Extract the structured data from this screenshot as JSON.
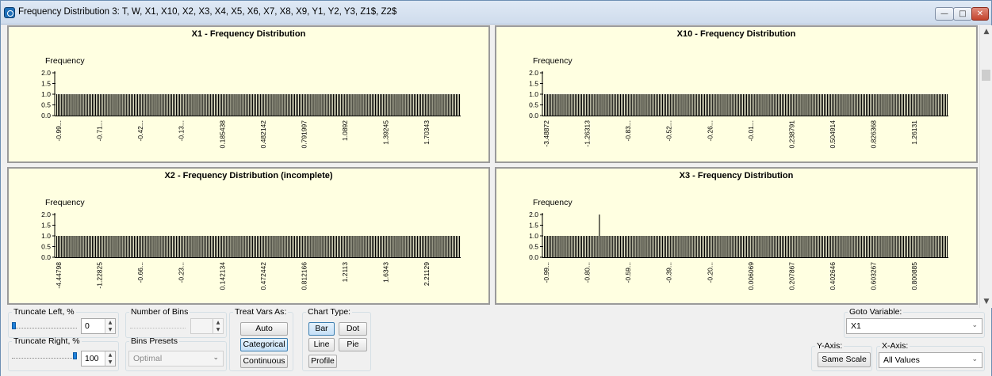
{
  "window": {
    "title": "Frequency Distribution 3: T, W, X1, X10, X2, X3, X4, X5, X6, X7, X8, X9, Y1, Y2, Y3, Z1$, Z2$",
    "controls": [
      "minimize",
      "maximize",
      "close"
    ]
  },
  "charts": [
    {
      "id": "x1",
      "title": "X1 - Frequency Distribution",
      "ylabel": "Frequency",
      "y_ticks": [
        "2.0",
        "1.5",
        "1.0",
        "0.5",
        "0.0"
      ],
      "x_ticks": [
        "-0.99...",
        "-0.71...",
        "-0.42...",
        "-0.13...",
        "0.185438",
        "0.482142",
        "0.791997",
        "1.0892",
        "1.39245",
        "1.70343"
      ]
    },
    {
      "id": "x10",
      "title": "X10 - Frequency Distribution",
      "ylabel": "Frequency",
      "y_ticks": [
        "2.0",
        "1.5",
        "1.0",
        "0.5",
        "0.0"
      ],
      "x_ticks": [
        "-3.48872",
        "-1.26313",
        "-0.83...",
        "-0.52...",
        "-0.26...",
        "-0.01...",
        "0.238791",
        "0.504914",
        "0.826368",
        "1.26131"
      ]
    },
    {
      "id": "x2",
      "title": "X2 - Frequency Distribution (incomplete)",
      "ylabel": "Frequency",
      "y_ticks": [
        "2.0",
        "1.5",
        "1.0",
        "0.5",
        "0.0"
      ],
      "x_ticks": [
        "-4.44798",
        "-1.22825",
        "-0.66...",
        "-0.23...",
        "0.142134",
        "0.472442",
        "0.812166",
        "1.2113",
        "1.6343",
        "2.21129"
      ]
    },
    {
      "id": "x3",
      "title": "X3 - Frequency Distribution",
      "ylabel": "Frequency",
      "y_ticks": [
        "2.0",
        "1.5",
        "1.0",
        "0.5",
        "0.0"
      ],
      "x_ticks": [
        "-0.99...",
        "-0.80...",
        "-0.59...",
        "-0.39...",
        "-0.20...",
        "0.006069",
        "0.207867",
        "0.402646",
        "0.603267",
        "0.800885"
      ]
    }
  ],
  "chart_data": [
    {
      "type": "bar",
      "title": "X1 - Frequency Distribution",
      "ylabel": "Frequency",
      "ylim": [
        0,
        2
      ],
      "bar_count": 250,
      "default_value": 1,
      "spikes": []
    },
    {
      "type": "bar",
      "title": "X10 - Frequency Distribution",
      "ylabel": "Frequency",
      "ylim": [
        0,
        2
      ],
      "bar_count": 250,
      "default_value": 1,
      "spikes": []
    },
    {
      "type": "bar",
      "title": "X2 - Frequency Distribution (incomplete)",
      "ylabel": "Frequency",
      "ylim": [
        0,
        2
      ],
      "bar_count": 250,
      "default_value": 1,
      "spikes": []
    },
    {
      "type": "bar",
      "title": "X3 - Frequency Distribution",
      "ylabel": "Frequency",
      "ylim": [
        0,
        2
      ],
      "bar_count": 250,
      "default_value": 1,
      "spikes": [
        {
          "bar": 34,
          "value": 2
        }
      ]
    }
  ],
  "controls": {
    "truncate_left": {
      "label": "Truncate  Left, %",
      "value": "0",
      "level": 0
    },
    "truncate_right": {
      "label": "Truncate Right, %",
      "value": "100",
      "level": 1
    },
    "number_of_bins": {
      "label": "Number of Bins",
      "value": ""
    },
    "bins_presets": {
      "label": "Bins Presets",
      "value": "Optimal"
    },
    "treat_vars_as": {
      "label": "Treat Vars As:",
      "options": [
        "Auto",
        "Categorical",
        "Continuous"
      ],
      "selected": "Categorical"
    },
    "chart_type": {
      "label": "Chart Type:",
      "options": [
        "Bar",
        "Dot",
        "Line",
        "Pie",
        "Profile"
      ],
      "selected": "Bar"
    },
    "goto_variable": {
      "label": "Goto Variable:",
      "value": "X1"
    },
    "y_axis": {
      "label": "Y-Axis:",
      "button": "Same Scale"
    },
    "x_axis": {
      "label": "X-Axis:",
      "value": "All Values"
    }
  }
}
